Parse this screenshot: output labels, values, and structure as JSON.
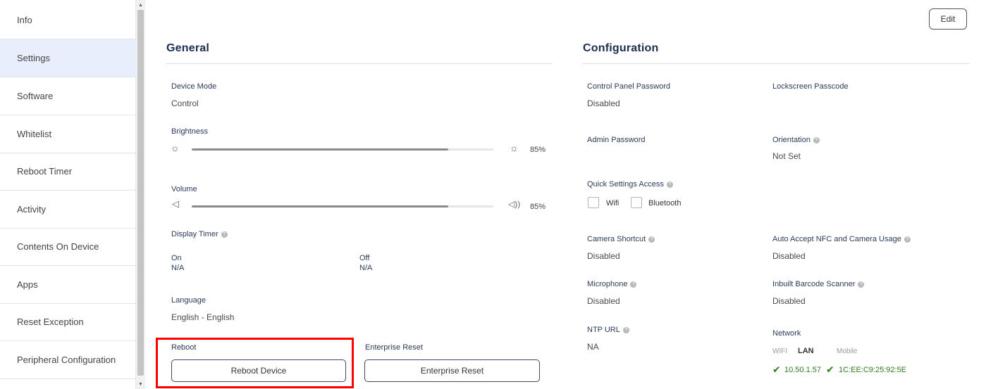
{
  "sidebar": {
    "items": [
      {
        "label": "Info"
      },
      {
        "label": "Settings"
      },
      {
        "label": "Software"
      },
      {
        "label": "Whitelist"
      },
      {
        "label": "Reboot Timer"
      },
      {
        "label": "Activity"
      },
      {
        "label": "Contents On Device"
      },
      {
        "label": "Apps"
      },
      {
        "label": "Reset Exception"
      },
      {
        "label": "Peripheral Configuration"
      }
    ],
    "active": "Settings"
  },
  "toolbar": {
    "edit_label": "Edit"
  },
  "general": {
    "title": "General",
    "device_mode": {
      "label": "Device Mode",
      "value": "Control"
    },
    "brightness": {
      "label": "Brightness",
      "percent_text": "85%",
      "level": 0.85,
      "icon": "sun-icon"
    },
    "volume": {
      "label": "Volume",
      "percent_text": "85%",
      "level": 0.85,
      "icon": "speaker-icon"
    },
    "display_timer": {
      "label": "Display Timer",
      "on_label": "On",
      "on_value": "N/A",
      "off_label": "Off",
      "off_value": "N/A"
    },
    "language": {
      "label": "Language",
      "value": "English - English"
    },
    "reboot": {
      "label": "Reboot",
      "button": "Reboot Device"
    },
    "enterprise_reset": {
      "label": "Enterprise Reset",
      "button": "Enterprise Reset"
    }
  },
  "configuration": {
    "title": "Configuration",
    "control_panel_password": {
      "label": "Control Panel Password",
      "value": "Disabled"
    },
    "lockscreen_passcode": {
      "label": "Lockscreen Passcode",
      "value": ""
    },
    "admin_password": {
      "label": "Admin Password",
      "value": ""
    },
    "orientation": {
      "label": "Orientation",
      "value": "Not Set"
    },
    "quick_settings": {
      "label": "Quick Settings Access",
      "wifi": "Wifi",
      "bluetooth": "Bluetooth"
    },
    "camera_shortcut": {
      "label": "Camera Shortcut",
      "value": "Disabled"
    },
    "auto_accept_nfc": {
      "label": "Auto Accept NFC and Camera Usage",
      "value": "Disabled"
    },
    "microphone": {
      "label": "Microphone",
      "value": "Disabled"
    },
    "barcode_scanner": {
      "label": "Inbuilt Barcode Scanner",
      "value": "Disabled"
    },
    "ntp_url": {
      "label": "NTP URL",
      "value": "NA"
    },
    "network": {
      "label": "Network",
      "tabs": [
        "WIFI",
        "LAN",
        "Mobile"
      ],
      "active_tab": "LAN",
      "ip": "10.50.1.57",
      "mac": "1C:EE:C9:25:92:5E",
      "ok_color": "#2e7d1f"
    }
  },
  "colors": {
    "accent": "#1c2d52",
    "highlight_box": "#ff0000",
    "active_nav": "#e8eefb"
  }
}
